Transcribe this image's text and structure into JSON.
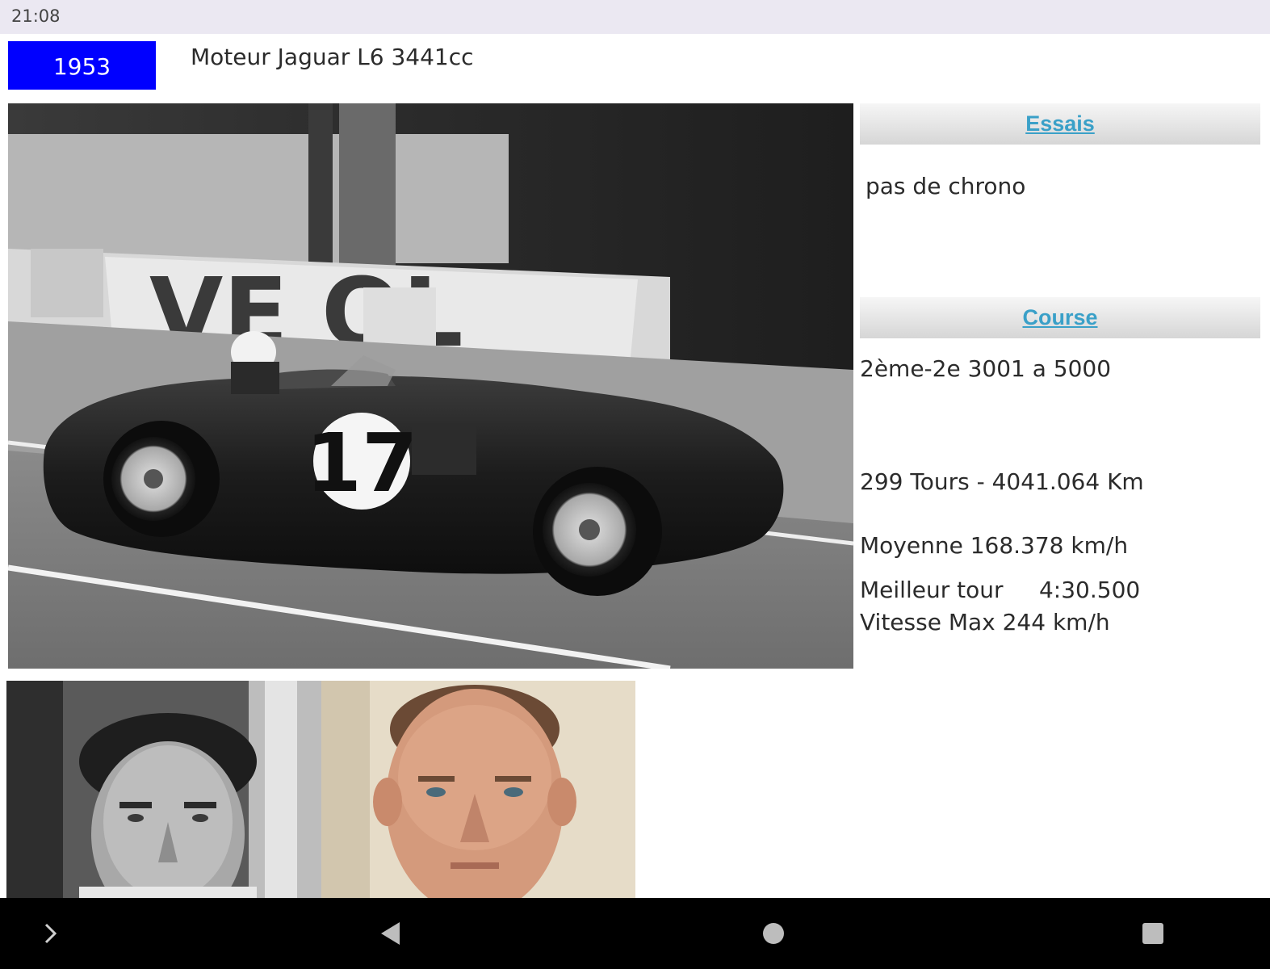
{
  "status_bar": {
    "time": "21:08"
  },
  "header": {
    "year": "1953",
    "engine": "Moteur Jaguar L6 3441cc"
  },
  "race_photo": {
    "car_number": "17",
    "banner_text": "VE   OL"
  },
  "essais": {
    "title": "Essais",
    "result": "pas de chrono"
  },
  "course": {
    "title": "Course",
    "position": "2ème-2e 3001 a 5000",
    "distance": "299 Tours - 4041.064 Km",
    "average": "Moyenne 168.378 km/h",
    "best_lap": "Meilleur tour     4:30.500",
    "max_speed": "Vitesse Max 244 km/h"
  },
  "nav": {
    "expand_icon": "chevron-right-icon",
    "back_icon": "back-triangle-icon",
    "home_icon": "home-circle-icon",
    "recents_icon": "recents-square-icon"
  },
  "colors": {
    "year_badge": "#0000ff",
    "section_title": "#3aa0c8",
    "status_bar": "#ebe8f2",
    "nav_bar": "#000000"
  }
}
